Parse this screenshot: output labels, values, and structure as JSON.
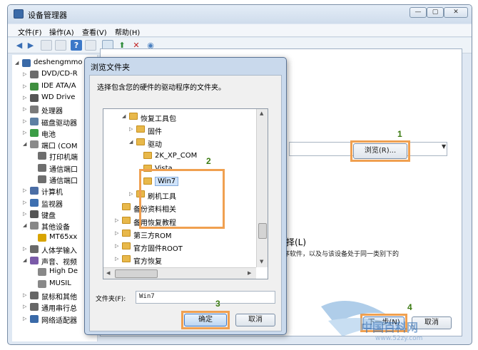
{
  "main_window": {
    "title": "设备管理器",
    "win_min": "—",
    "win_max": "▢",
    "win_close": "✕",
    "menu": [
      "文件(F)",
      "操作(A)",
      "查看(V)",
      "帮助(H)"
    ]
  },
  "device_tree": [
    {
      "label": "deshengmmo",
      "arrow": "◢",
      "indent": 0
    },
    {
      "label": "DVD/CD-R",
      "arrow": "▷",
      "indent": 1
    },
    {
      "label": "IDE ATA/A",
      "arrow": "▷",
      "indent": 1
    },
    {
      "label": "WD Drive",
      "arrow": "▷",
      "indent": 1
    },
    {
      "label": "处理器",
      "arrow": "▷",
      "indent": 1
    },
    {
      "label": "磁盘驱动器",
      "arrow": "▷",
      "indent": 1
    },
    {
      "label": "电池",
      "arrow": "▷",
      "indent": 1
    },
    {
      "label": "端口 (COM",
      "arrow": "◢",
      "indent": 1
    },
    {
      "label": "打印机端",
      "arrow": "",
      "indent": 2
    },
    {
      "label": "通信端口",
      "arrow": "",
      "indent": 2
    },
    {
      "label": "通信端口",
      "arrow": "",
      "indent": 2
    },
    {
      "label": "计算机",
      "arrow": "▷",
      "indent": 1
    },
    {
      "label": "监视器",
      "arrow": "▷",
      "indent": 1
    },
    {
      "label": "键盘",
      "arrow": "▷",
      "indent": 1
    },
    {
      "label": "其他设备",
      "arrow": "◢",
      "indent": 1
    },
    {
      "label": "MT65xx",
      "arrow": "",
      "indent": 2
    },
    {
      "label": "人体学输入",
      "arrow": "▷",
      "indent": 1
    },
    {
      "label": "声音、视频",
      "arrow": "◢",
      "indent": 1
    },
    {
      "label": "High De",
      "arrow": "",
      "indent": 2
    },
    {
      "label": "MUSIL",
      "arrow": "",
      "indent": 2
    },
    {
      "label": "鼠标和其他",
      "arrow": "▷",
      "indent": 1
    },
    {
      "label": "通用串行总",
      "arrow": "▷",
      "indent": 1
    },
    {
      "label": "网络适配器",
      "arrow": "▷",
      "indent": 1
    }
  ],
  "wizard": {
    "browse_label": "浏览(R)...",
    "option_text": "择(L)",
    "description": "序软件，以及与该设备处于同一类别下的",
    "next_label": "下一步(N)",
    "cancel_label": "取消",
    "dropdown_arrow": "▼"
  },
  "browse_dialog": {
    "title": "浏览文件夹",
    "prompt": "选择包含您的硬件的驱动程序的文件夹。",
    "folders": [
      {
        "label": "恢复工具包",
        "arrow": "◢",
        "indent": 3
      },
      {
        "label": "固件",
        "arrow": "▷",
        "indent": 4
      },
      {
        "label": "驱动",
        "arrow": "◢",
        "indent": 4
      },
      {
        "label": "2K_XP_COM",
        "arrow": "",
        "indent": 5
      },
      {
        "label": "Vista",
        "arrow": "",
        "indent": 5
      },
      {
        "label": "Win7",
        "arrow": "",
        "indent": 5,
        "selected": true
      },
      {
        "label": "刷机工具",
        "arrow": "▷",
        "indent": 4
      },
      {
        "label": "备份资料相关",
        "arrow": "",
        "indent": 2
      },
      {
        "label": "备用恢复教程",
        "arrow": "▷",
        "indent": 2
      },
      {
        "label": "第三方ROM",
        "arrow": "▷",
        "indent": 2
      },
      {
        "label": "官方固件ROOT",
        "arrow": "▷",
        "indent": 2
      },
      {
        "label": "官方恢复",
        "arrow": "▷",
        "indent": 2
      }
    ],
    "folder_label": "文件夹(F):",
    "folder_value": "Win7",
    "ok_label": "确定",
    "cancel_label": "取消",
    "scroll_up": "▲",
    "scroll_down": "▼",
    "scroll_left": "◀",
    "scroll_right": "▶"
  },
  "steps": [
    "1",
    "2",
    "3",
    "4"
  ],
  "watermark": {
    "text": "中国百科网",
    "url": "www.52zy.com"
  },
  "colors": {
    "highlight": "#f0a050",
    "step_number": "#3a7a10",
    "selected_bg": "#cfe3fa"
  }
}
